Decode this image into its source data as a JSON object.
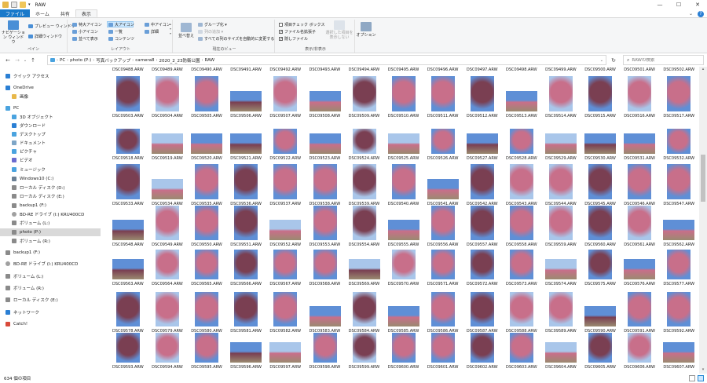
{
  "window": {
    "title": "RAW",
    "controls": [
      "—",
      "☐",
      "✕"
    ]
  },
  "ribbon_tabs": [
    {
      "label": "ファイル",
      "kind": "file"
    },
    {
      "label": "ホーム",
      "kind": "normal"
    },
    {
      "label": "共有",
      "kind": "normal"
    },
    {
      "label": "表示",
      "kind": "active"
    }
  ],
  "ribbon_right": [
    "⌄",
    "?"
  ],
  "ribbon": {
    "pane_group": {
      "label": "ペイン",
      "nav_pane": "ナビゲーション ウィンドウ",
      "preview": "プレビュー ウィンドウ",
      "details": "詳細ウィンドウ"
    },
    "layout_group": {
      "label": "レイアウト",
      "items": [
        "特大アイコン",
        "大アイコン",
        "中アイコン",
        "小アイコン",
        "一覧",
        "詳細",
        "並べて表示",
        "コンテンツ"
      ]
    },
    "view_group": {
      "label": "現在のビュー",
      "sort": "並べ替え",
      "group_by": "グループ化 ▾",
      "add_column": "列の追加 ▾",
      "fit_columns": "すべての列のサイズを自動的に変更する"
    },
    "showhide_group": {
      "label": "表示/非表示",
      "checkboxes": [
        {
          "label": "項目チェック ボックス",
          "checked": false
        },
        {
          "label": "ファイル名拡張子",
          "checked": true
        },
        {
          "label": "隠しファイル",
          "checked": true
        }
      ],
      "hide_selected": "選択した項目を表示しない"
    },
    "options": "オプション"
  },
  "address": {
    "crumbs": [
      "PC",
      "photo (P:)",
      "写真バックアップ",
      "camera8",
      "2020_2_23防衛公園",
      "RAW"
    ],
    "search_placeholder": "RAWの検索"
  },
  "nav": [
    {
      "label": "クイック アクセス",
      "icon": "star-icon",
      "color": "#2a7fd4",
      "indent": 0,
      "selected": false
    },
    {
      "label": "OneDrive",
      "icon": "cloud-icon",
      "color": "#2a7fd4",
      "indent": 0,
      "selected": false
    },
    {
      "label": "画像",
      "icon": "folder-icon",
      "color": "#e8b84a",
      "indent": 1,
      "selected": false
    },
    {
      "label": "PC",
      "icon": "pc-icon",
      "color": "#4aa3df",
      "indent": 0,
      "selected": false
    },
    {
      "label": "3D オブジェクト",
      "icon": "cube-icon",
      "color": "#4aa3df",
      "indent": 1,
      "selected": false
    },
    {
      "label": "ダウンロード",
      "icon": "download-icon",
      "color": "#2a7fd4",
      "indent": 1,
      "selected": false
    },
    {
      "label": "デスクトップ",
      "icon": "desktop-icon",
      "color": "#4aa3df",
      "indent": 1,
      "selected": false
    },
    {
      "label": "ドキュメント",
      "icon": "document-icon",
      "color": "#7ea6c7",
      "indent": 1,
      "selected": false
    },
    {
      "label": "ピクチャ",
      "icon": "picture-icon",
      "color": "#4aa3df",
      "indent": 1,
      "selected": false
    },
    {
      "label": "ビデオ",
      "icon": "video-icon",
      "color": "#6b6bcf",
      "indent": 1,
      "selected": false
    },
    {
      "label": "ミュージック",
      "icon": "music-icon",
      "color": "#4aa3df",
      "indent": 1,
      "selected": false
    },
    {
      "label": "Windows10 (C:)",
      "icon": "drive-icon",
      "color": "#6b7f93",
      "indent": 1,
      "selected": false
    },
    {
      "label": "ローカル ディスク (D:)",
      "icon": "drive-icon",
      "color": "#8a8a8a",
      "indent": 1,
      "selected": false
    },
    {
      "label": "ローカル ディスク (E:)",
      "icon": "drive-icon",
      "color": "#8a8a8a",
      "indent": 1,
      "selected": false
    },
    {
      "label": "backup1 (F:)",
      "icon": "drive-icon",
      "color": "#8a8a8a",
      "indent": 1,
      "selected": false
    },
    {
      "label": "BD-RE ドライブ (I:) KRU400CD",
      "icon": "disc-icon",
      "color": "#a0a0a0",
      "indent": 1,
      "selected": false
    },
    {
      "label": "ボリューム (L:)",
      "icon": "drive-icon",
      "color": "#8a8a8a",
      "indent": 1,
      "selected": false
    },
    {
      "label": "photo (P:)",
      "icon": "drive-icon",
      "color": "#8a8a8a",
      "indent": 1,
      "selected": true
    },
    {
      "label": "ボリューム (R:)",
      "icon": "drive-icon",
      "color": "#8a8a8a",
      "indent": 1,
      "selected": false
    },
    {
      "label": "backup1 (F:)",
      "icon": "drive-icon",
      "color": "#8a8a8a",
      "indent": 0,
      "selected": false
    },
    {
      "label": "BD-RE ドライブ (I:) KRU400CD",
      "icon": "disc-icon",
      "color": "#a0a0a0",
      "indent": 0,
      "selected": false
    },
    {
      "label": "ボリューム (L:)",
      "icon": "drive-icon",
      "color": "#8a8a8a",
      "indent": 0,
      "selected": false
    },
    {
      "label": "ボリューム (R:)",
      "icon": "drive-icon",
      "color": "#8a8a8a",
      "indent": 0,
      "selected": false
    },
    {
      "label": "ローカル ディスク (E:)",
      "icon": "drive-icon",
      "color": "#8a8a8a",
      "indent": 0,
      "selected": false
    },
    {
      "label": "ネットワーク",
      "icon": "network-icon",
      "color": "#2a7fd4",
      "indent": 0,
      "selected": false
    },
    {
      "label": "Catch!",
      "icon": "catch-icon",
      "color": "#d94a3a",
      "indent": 0,
      "selected": false
    }
  ],
  "first_row_labels": [
    "DSC09488.ARW",
    "DSC09489.ARW",
    "DSC09490.ARW",
    "DSC09491.ARW",
    "DSC09492.ARW",
    "DSC09493.ARW",
    "DSC09494.ARW",
    "DSC09495.ARW",
    "DSC09496.ARW",
    "DSC09497.ARW",
    "DSC09498.ARW",
    "DSC09499.ARW",
    "DSC09500.ARW",
    "DSC09501.ARW",
    "DSC09502.ARW"
  ],
  "files": {
    "prefix": "DSC",
    "extension": ".ARW",
    "start": 9503,
    "count": 105,
    "columns": 15
  },
  "thumb_colors": {
    "blossom": "#c86f8a",
    "blossom_dark": "#7a3f52",
    "sky": "#5f8fd6",
    "sky_light": "#a9c6ea",
    "ground": "#9a8a70"
  },
  "status": {
    "count": "634 個の項目"
  },
  "scroll_fraction": 0.33
}
